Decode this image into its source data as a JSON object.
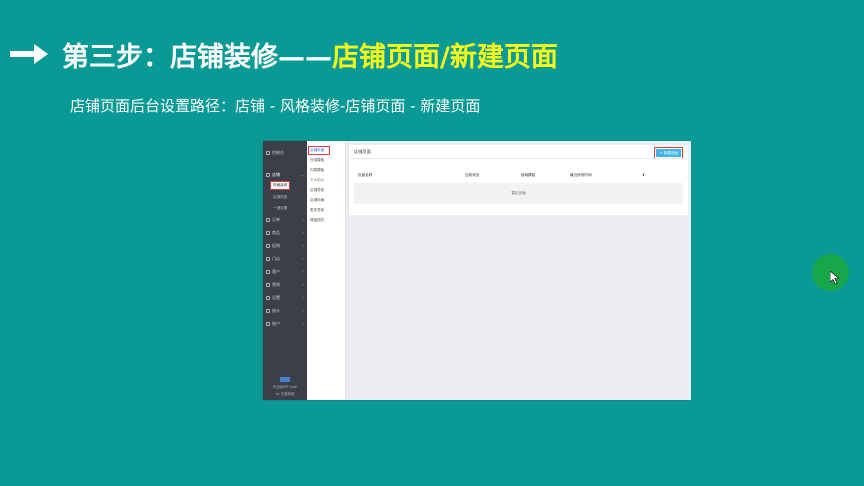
{
  "slide": {
    "title_part1": "第三步：店铺装修——",
    "title_part2": "店铺页面/新建页面",
    "subtitle": "店铺页面后台设置路径：店铺 - 风格装修-店铺页面 - 新建页面",
    "colors": {
      "background": "#0a9a96",
      "highlight": "#f6f81a",
      "text": "#ffffff",
      "annotation": "#e23a3a"
    }
  },
  "screenshot": {
    "sidebar": {
      "items": [
        {
          "label": "控制台",
          "icon": "dashboard-icon"
        },
        {
          "label": "店铺",
          "icon": "store-icon",
          "active": true
        },
        {
          "label": "订单",
          "icon": "order-icon"
        },
        {
          "label": "商品",
          "icon": "goods-icon"
        },
        {
          "label": "促销",
          "icon": "promotion-icon"
        },
        {
          "label": "门店",
          "icon": "shop-icon"
        },
        {
          "label": "客户",
          "icon": "customer-icon"
        },
        {
          "label": "营销",
          "icon": "marketing-icon"
        },
        {
          "label": "设置",
          "icon": "settings-icon"
        },
        {
          "label": "统计",
          "icon": "stats-icon"
        },
        {
          "label": "账户",
          "icon": "account-icon"
        }
      ],
      "subitems": [
        "风格装修",
        "店铺信息",
        "一键设置"
      ],
      "footer_line1": "专业版SPF mall",
      "footer_line2": "by 天猫商城"
    },
    "subnav": {
      "items": [
        "店铺页面",
        "分类模板",
        "列表模板",
        "个人中心",
        "店铺导航",
        "店铺风格",
        "更多导航",
        "弹窗插件"
      ]
    },
    "panel": {
      "title": "店铺页面",
      "new_button": "+ 新建页面",
      "columns": [
        "页面名称",
        "当前状态",
        "使用模板",
        "最近修改时间"
      ],
      "empty_text": "暂无页面"
    }
  }
}
